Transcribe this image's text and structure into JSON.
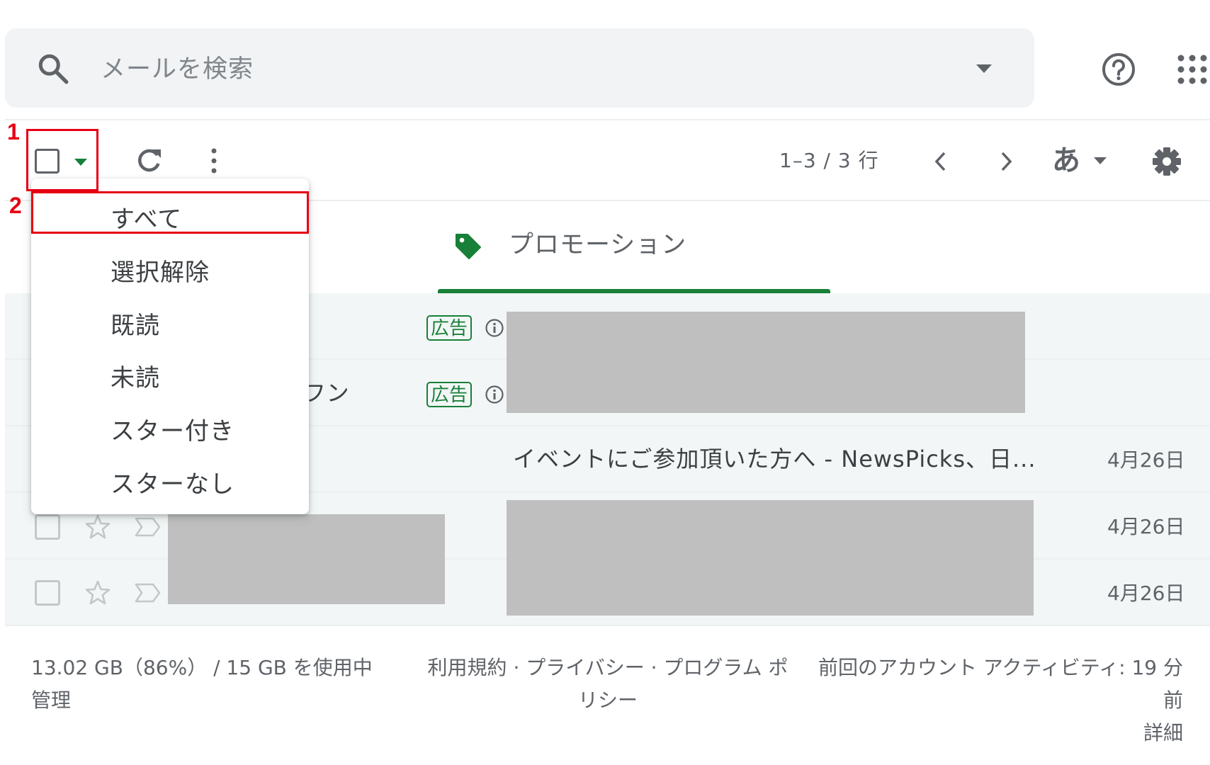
{
  "search": {
    "placeholder": "メールを検索"
  },
  "toolbar": {
    "page_count": "1–3 / 3 行",
    "ime_label": "あ"
  },
  "annotations": {
    "step1": "1",
    "step2": "2"
  },
  "select_menu": {
    "items": [
      {
        "label": "すべて"
      },
      {
        "label": "選択解除"
      },
      {
        "label": "既読"
      },
      {
        "label": "未読"
      },
      {
        "label": "スター付き"
      },
      {
        "label": "スターなし"
      }
    ]
  },
  "tabs": [
    {
      "label": "プロモーション",
      "icon": "tag-icon",
      "active": true
    }
  ],
  "emails": [
    {
      "ad_badge": "広告",
      "sender_partial": "",
      "subject": "",
      "date": ""
    },
    {
      "ad_badge": "広告",
      "sender_partial": "フン",
      "subject": "",
      "date": ""
    },
    {
      "ad_badge": "",
      "sender_partial": "",
      "subject": "イベントにご参加頂いた方へ - NewsPicks、日...",
      "date": "4月26日"
    },
    {
      "ad_badge": "",
      "sender_partial": "",
      "subject": "",
      "date": "4月26日"
    },
    {
      "ad_badge": "",
      "sender_partial": "",
      "subject": "",
      "date": "4月26日"
    }
  ],
  "footer": {
    "storage": "13.02 GB（86%） / 15 GB を使用中",
    "manage": "管理",
    "terms": "利用規約",
    "privacy": "プライバシー",
    "program_policy_1": "プログラム ポ",
    "program_policy_2": "リシー",
    "separator": "·",
    "activity_1": "前回のアカウント アクティビティ: 19 分",
    "activity_2": "前",
    "details": "詳細"
  },
  "colors": {
    "accent_green": "#188038",
    "annotation_red": "#e60012",
    "redaction_grey": "#bfbfbf"
  }
}
